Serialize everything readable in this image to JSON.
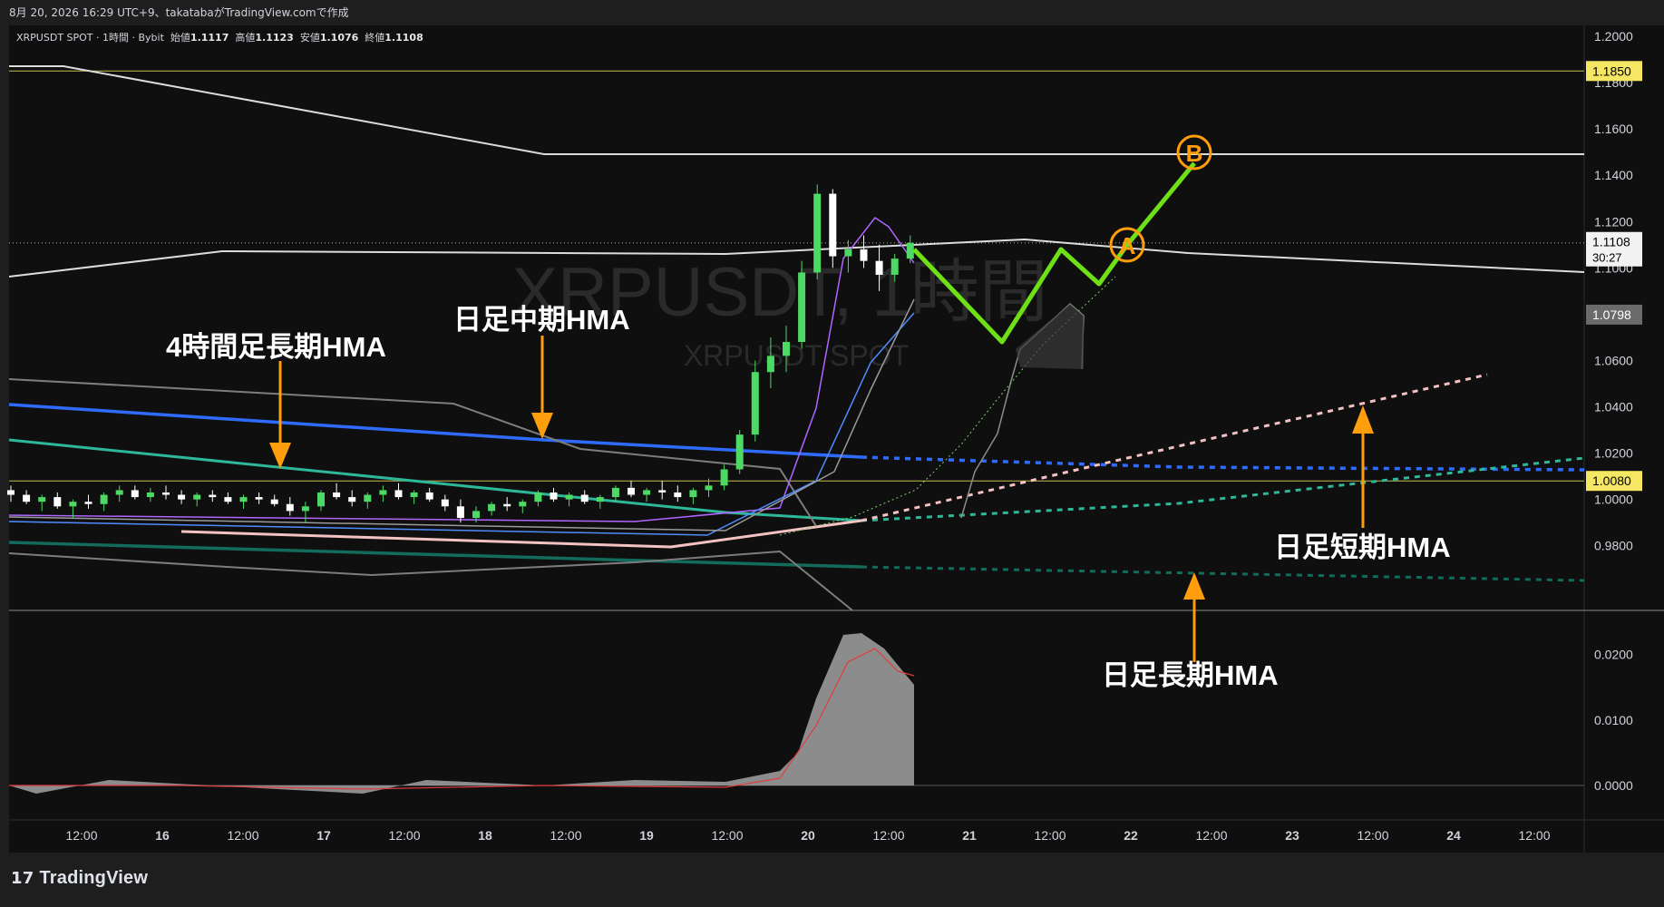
{
  "header": {
    "caption": "8月 20, 2026 16:29 UTC+9、takatabaがTradingView.comで作成"
  },
  "legend": {
    "symbol": "XRPUSDT SPOT · 1時間 · Bybit",
    "open_label": "始値",
    "open": "1.1117",
    "high_label": "高値",
    "high": "1.1123",
    "low_label": "安値",
    "low": "1.1076",
    "close_label": "終値",
    "close": "1.1108"
  },
  "watermark": {
    "title": "XRPUSDT, 1時間",
    "subtitle": "XRPUSDT SPOT"
  },
  "price_axis": {
    "ticks": [
      "1.2000",
      "1.1800",
      "1.1600",
      "1.1400",
      "1.1200",
      "1.1000",
      "1.0600",
      "1.0400",
      "1.0200",
      "1.0000",
      "0.9800"
    ],
    "badges": [
      {
        "label": "1.1850",
        "value": 1.185,
        "bg": "#f5e663",
        "fg": "#000000"
      },
      {
        "label": "1.1108",
        "value": 1.1108,
        "bg": "#f2f2f2",
        "fg": "#000000",
        "sub": "30:27"
      },
      {
        "label": "1.0798",
        "value": 1.0798,
        "bg": "#6b6b6b",
        "fg": "#ffffff"
      },
      {
        "label": "1.0080",
        "value": 1.008,
        "bg": "#f5e663",
        "fg": "#000000"
      }
    ]
  },
  "osc_axis": {
    "ticks": [
      "0.0200",
      "0.0100",
      "0.0000"
    ]
  },
  "time_axis": {
    "labels": [
      "12:00",
      "16",
      "12:00",
      "17",
      "12:00",
      "18",
      "12:00",
      "19",
      "12:00",
      "20",
      "12:00",
      "21",
      "12:00",
      "22",
      "12:00",
      "23",
      "12:00",
      "24",
      "12:00"
    ]
  },
  "annotations": {
    "hma4h_long": "4時間足長期HMA",
    "daily_mid": "日足中期HMA",
    "daily_short": "日足短期HMA",
    "daily_long": "日足長期HMA",
    "point_a": "A",
    "point_b": "B"
  },
  "colors": {
    "bg": "#0f0f0f",
    "up": "#4cd964",
    "down": "#ffffff",
    "blue_hma": "#2f6bff",
    "teal_hma": "#2eb89a",
    "pink_hma": "#f4c2c2",
    "dark_teal_hma": "#136b5c",
    "scenario": "#6ee016",
    "orange": "#ff9e0d",
    "yellow": "#f5e663"
  },
  "chart_data": {
    "type": "candlestick",
    "title": "XRPUSDT, 1時間",
    "price_range": [
      0.965,
      1.2
    ],
    "osc_range": [
      -0.002,
      0.023
    ],
    "candles": [
      [
        0,
        1.004,
        1.006,
        0.999,
        1.002
      ],
      [
        1,
        1.002,
        1.004,
        0.998,
        0.999
      ],
      [
        2,
        0.999,
        1.002,
        0.995,
        1.001
      ],
      [
        3,
        1.001,
        1.003,
        0.996,
        0.997
      ],
      [
        4,
        0.997,
        1.0,
        0.992,
        0.999
      ],
      [
        5,
        0.999,
        1.002,
        0.996,
        0.998
      ],
      [
        6,
        0.998,
        1.003,
        0.995,
        1.002
      ],
      [
        7,
        1.002,
        1.006,
        0.999,
        1.004
      ],
      [
        8,
        1.004,
        1.006,
        1.0,
        1.001
      ],
      [
        9,
        1.001,
        1.005,
        0.999,
        1.003
      ],
      [
        10,
        1.003,
        1.006,
        1.0,
        1.002
      ],
      [
        11,
        1.002,
        1.004,
        0.998,
        1.0
      ],
      [
        12,
        1.0,
        1.003,
        0.997,
        1.002
      ],
      [
        13,
        1.002,
        1.004,
        0.999,
        1.001
      ],
      [
        14,
        1.001,
        1.003,
        0.998,
        0.999
      ],
      [
        15,
        0.999,
        1.002,
        0.996,
        1.001
      ],
      [
        16,
        1.001,
        1.003,
        0.998,
        1.0
      ],
      [
        17,
        1.0,
        1.002,
        0.997,
        0.998
      ],
      [
        18,
        0.998,
        1.001,
        0.993,
        0.995
      ],
      [
        19,
        0.995,
        0.999,
        0.99,
        0.997
      ],
      [
        20,
        0.997,
        1.004,
        0.995,
        1.003
      ],
      [
        21,
        1.003,
        1.007,
        1.0,
        1.001
      ],
      [
        22,
        1.001,
        1.004,
        0.997,
        0.999
      ],
      [
        23,
        0.999,
        1.003,
        0.996,
        1.002
      ],
      [
        24,
        1.002,
        1.006,
        0.999,
        1.004
      ],
      [
        25,
        1.004,
        1.007,
        1.0,
        1.001
      ],
      [
        26,
        1.001,
        1.004,
        0.998,
        1.003
      ],
      [
        27,
        1.003,
        1.005,
        0.999,
        1.0
      ],
      [
        28,
        1.0,
        1.002,
        0.995,
        0.997
      ],
      [
        29,
        0.997,
        1.0,
        0.99,
        0.992
      ],
      [
        30,
        0.992,
        0.997,
        0.99,
        0.995
      ],
      [
        31,
        0.995,
        0.999,
        0.993,
        0.998
      ],
      [
        32,
        0.998,
        1.001,
        0.995,
        0.997
      ],
      [
        33,
        0.997,
        1.0,
        0.994,
        0.999
      ],
      [
        34,
        0.999,
        1.004,
        0.997,
        1.003
      ],
      [
        35,
        1.003,
        1.005,
        0.999,
        1.0
      ],
      [
        36,
        1.0,
        1.003,
        0.997,
        1.002
      ],
      [
        37,
        1.002,
        1.004,
        0.998,
        0.999
      ],
      [
        38,
        0.999,
        1.002,
        0.996,
        1.001
      ],
      [
        39,
        1.001,
        1.006,
        0.999,
        1.005
      ],
      [
        40,
        1.005,
        1.008,
        1.001,
        1.002
      ],
      [
        41,
        1.002,
        1.005,
        0.999,
        1.004
      ],
      [
        42,
        1.004,
        1.008,
        1.0,
        1.003
      ],
      [
        43,
        1.003,
        1.006,
        0.999,
        1.001
      ],
      [
        44,
        1.001,
        1.005,
        0.998,
        1.004
      ],
      [
        45,
        1.004,
        1.009,
        1.001,
        1.006
      ],
      [
        46,
        1.006,
        1.015,
        1.004,
        1.013
      ],
      [
        47,
        1.013,
        1.03,
        1.011,
        1.028
      ],
      [
        48,
        1.028,
        1.06,
        1.025,
        1.055
      ],
      [
        49,
        1.055,
        1.07,
        1.048,
        1.062
      ],
      [
        50,
        1.062,
        1.075,
        1.055,
        1.068
      ],
      [
        51,
        1.068,
        1.103,
        1.065,
        1.098
      ],
      [
        52,
        1.098,
        1.136,
        1.095,
        1.132
      ],
      [
        53,
        1.132,
        1.134,
        1.1,
        1.105
      ],
      [
        54,
        1.105,
        1.112,
        1.098,
        1.108
      ],
      [
        55,
        1.108,
        1.114,
        1.1,
        1.103
      ],
      [
        56,
        1.103,
        1.11,
        1.09,
        1.097
      ],
      [
        57,
        1.097,
        1.106,
        1.094,
        1.104
      ],
      [
        58,
        1.104,
        1.114,
        1.102,
        1.1108
      ]
    ],
    "scenario_path": [
      {
        "time": "day21",
        "price": 1.111
      },
      {
        "time": "day21-12",
        "price": 1.073
      },
      {
        "time": "day22-00",
        "price": 1.112
      },
      {
        "time": "day22-04",
        "price": 1.1
      },
      {
        "time": "point A",
        "price": 1.113
      },
      {
        "time": "point B",
        "price": 1.147
      }
    ],
    "hlines": [
      1.185,
      1.008
    ]
  }
}
